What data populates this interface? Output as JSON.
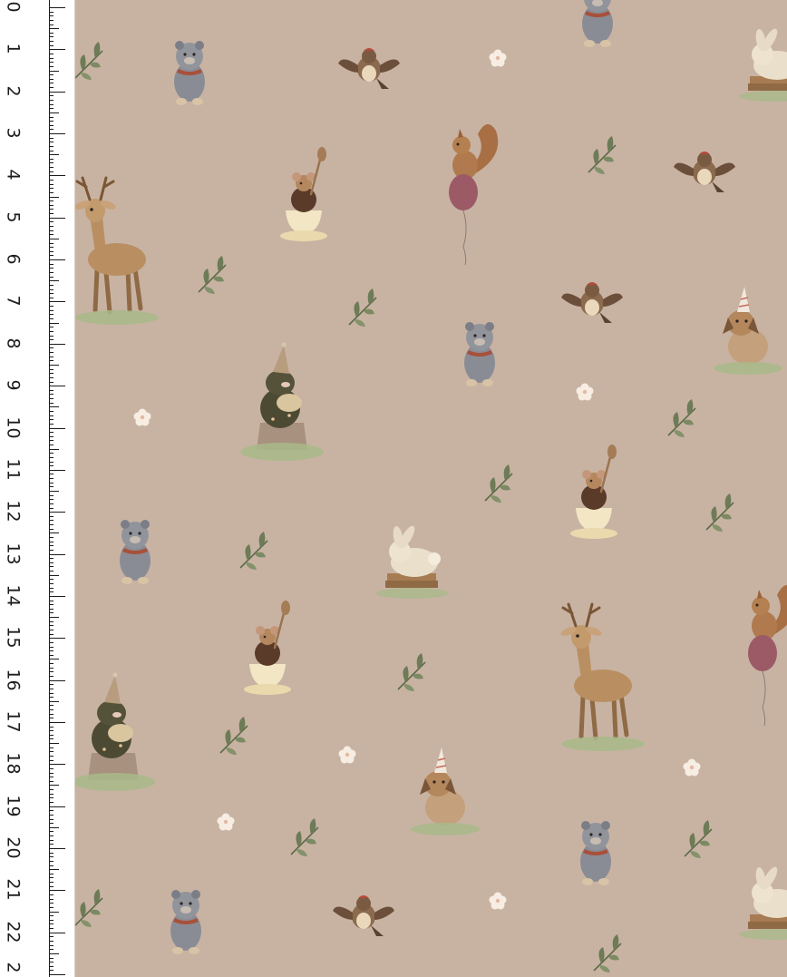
{
  "ruler": {
    "labels": [
      "0",
      "1",
      "2",
      "3",
      "4",
      "5",
      "6",
      "7",
      "8",
      "9",
      "10",
      "11",
      "12",
      "13",
      "14",
      "15",
      "16",
      "17",
      "18",
      "19",
      "20",
      "21",
      "22",
      "2"
    ]
  },
  "colors": {
    "background": "#c8b3a3",
    "ruler": "#ffffff",
    "ink": "#1c1c1c"
  },
  "motifs": [
    {
      "kind": "bear-icon"
    },
    {
      "kind": "bird-icon"
    },
    {
      "kind": "flower-icon"
    },
    {
      "kind": "leaf-icon"
    },
    {
      "kind": "squirrel-balloon-icon"
    },
    {
      "kind": "deer-icon"
    },
    {
      "kind": "mouse-teacup-icon"
    },
    {
      "kind": "mole-stump-icon"
    },
    {
      "kind": "dog-party-hat-icon"
    },
    {
      "kind": "bunny-books-icon"
    }
  ]
}
